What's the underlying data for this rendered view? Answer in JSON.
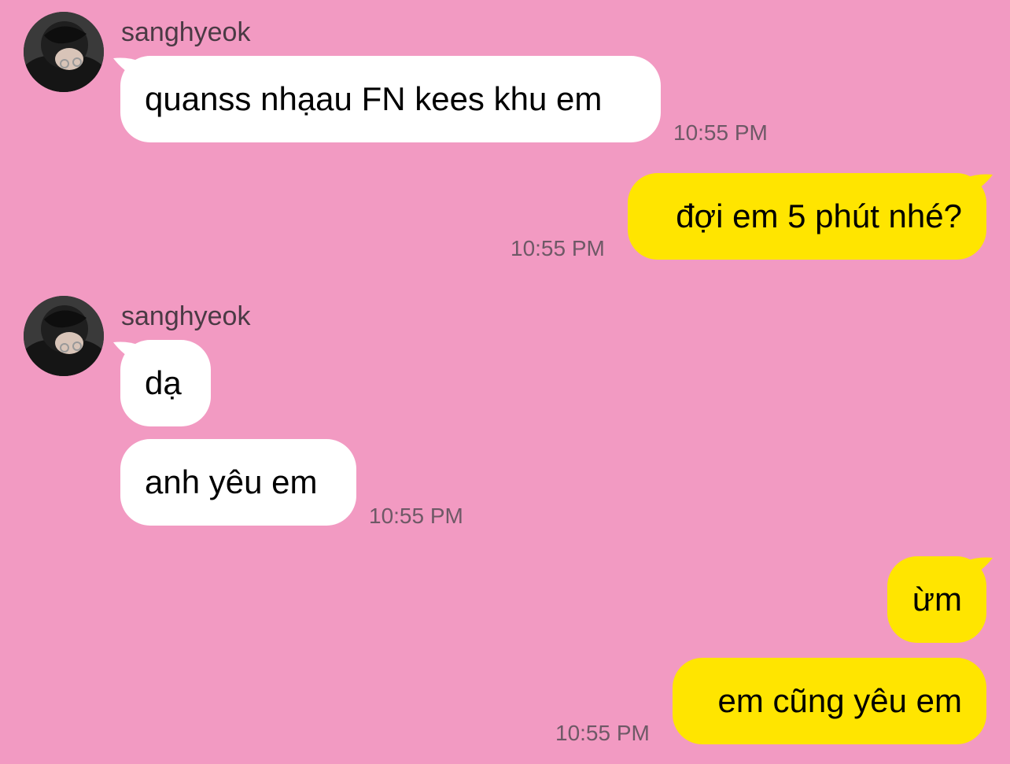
{
  "colors": {
    "background": "#F29AC2",
    "incoming_bubble": "#FFFFFF",
    "outgoing_bubble": "#FFE500",
    "timestamp": "#6e5966"
  },
  "groups": [
    {
      "sender": "sanghyeok",
      "avatar_icon": "profile-photo-avatar",
      "messages": [
        "quanss nhạau FN kees khu em"
      ],
      "time": "10:55 PM"
    },
    {
      "sender": "me",
      "messages": [
        "đợi em 5 phút nhé?"
      ],
      "time": "10:55 PM"
    },
    {
      "sender": "sanghyeok",
      "avatar_icon": "profile-photo-avatar",
      "messages": [
        "dạ",
        "anh yêu em"
      ],
      "time": "10:55 PM"
    },
    {
      "sender": "me",
      "messages": [
        "ừm",
        "em cũng yêu em"
      ],
      "time": "10:55 PM"
    }
  ]
}
